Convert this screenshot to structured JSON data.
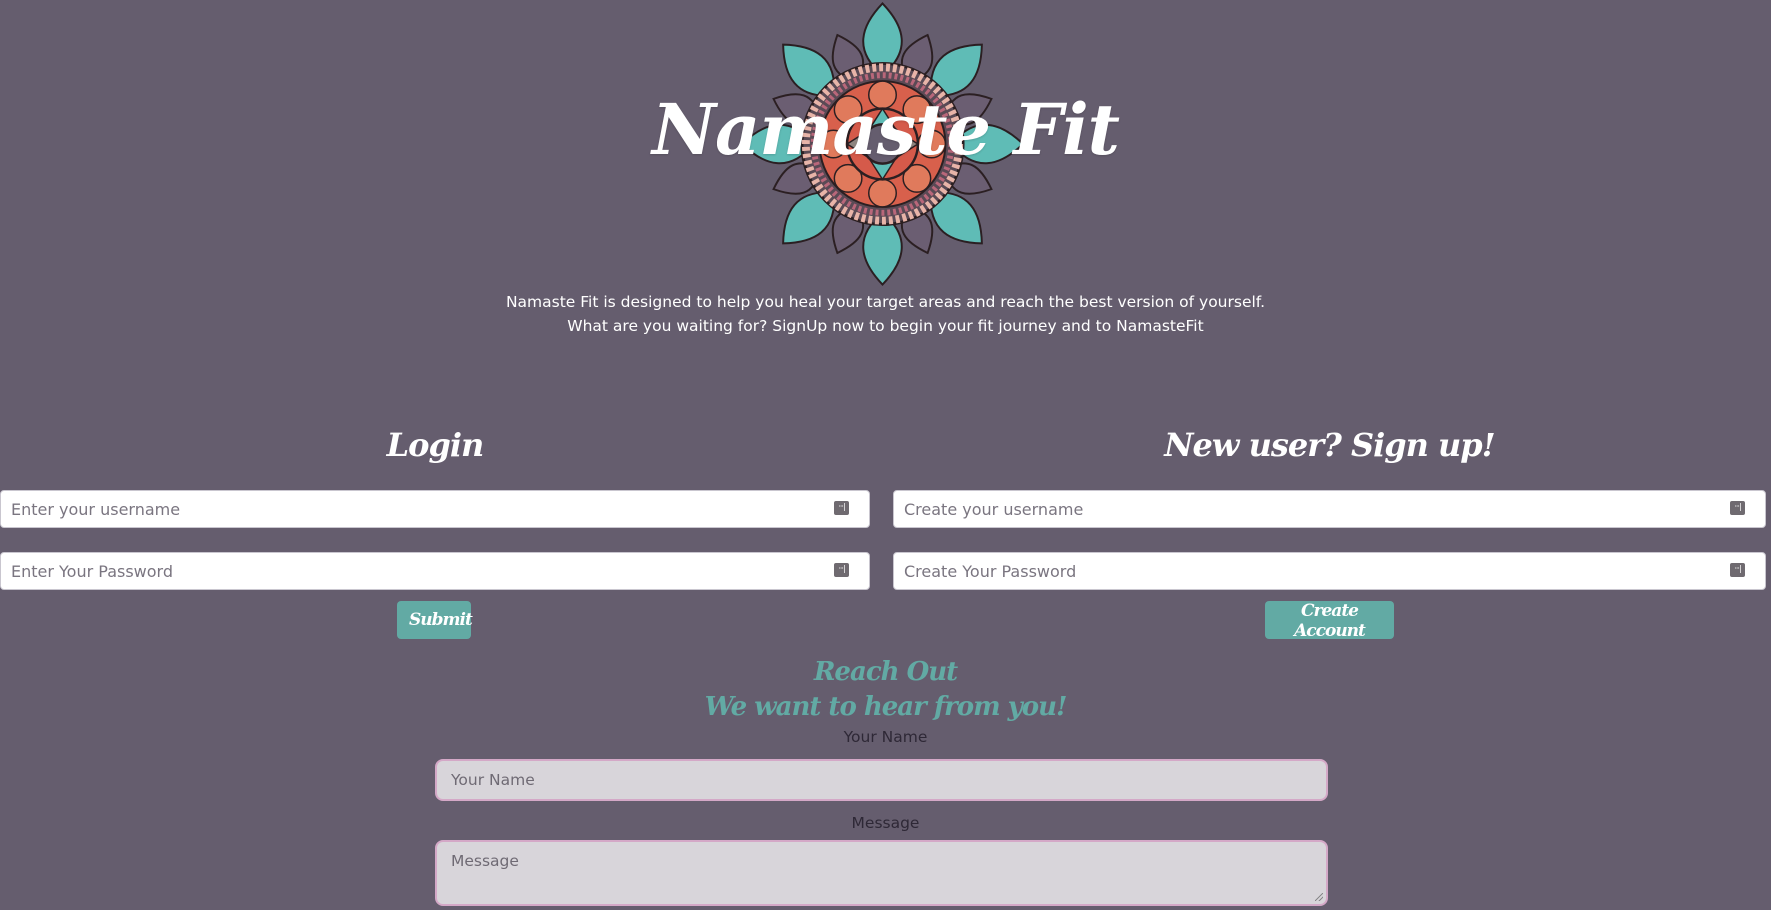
{
  "brand": {
    "title": "Namaste Fit",
    "logo_icon": "mandala-icon"
  },
  "tagline": {
    "line1": "Namaste Fit is designed to help you heal your target areas and reach the best version of yourself.",
    "line2": "What are you waiting for? SignUp now to begin your fit journey and to NamasteFit"
  },
  "login": {
    "heading": "Login",
    "username_placeholder": "Enter your username",
    "password_placeholder": "Enter Your Password",
    "submit_label": "Submit"
  },
  "signup": {
    "heading": "New user? Sign up!",
    "username_placeholder": "Create your username",
    "password_placeholder": "Create Your Password",
    "submit_label": "Create Account"
  },
  "contact": {
    "heading1": "Reach Out",
    "heading2": "We want to hear from you!",
    "name_label": "Your Name",
    "name_placeholder": "Your Name",
    "message_label": "Message",
    "message_placeholder": "Message"
  },
  "colors": {
    "background": "#655d6e",
    "accent_teal": "#62aaa4",
    "input_border_pink": "#d4a8c7"
  }
}
